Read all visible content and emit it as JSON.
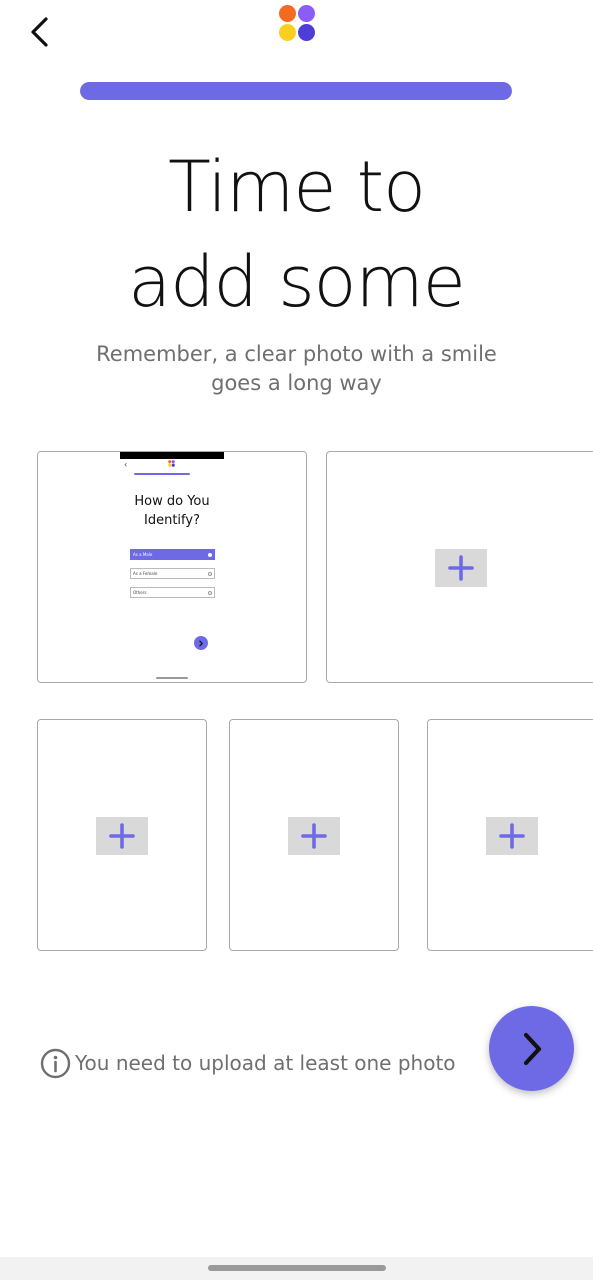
{
  "header": {
    "back_icon": "chevron-left-icon",
    "logo_icon": "four-petal-logo-icon",
    "progress_fraction": 1.0,
    "accent_color": "#6e6ae6"
  },
  "main": {
    "title_line1": "Time to",
    "title_line2": "add some",
    "subtitle_line1": "Remember, a clear photo with a smile",
    "subtitle_line2": "goes a long way"
  },
  "photos": {
    "slot_count": 5,
    "filled_slots": 1,
    "add_icon": "plus-icon",
    "thumbnail": {
      "title_line1": "How do You",
      "title_line2": "Identify?",
      "options": [
        "As a Male",
        "As a Female",
        "Others"
      ]
    }
  },
  "footer": {
    "notice_icon": "info-icon",
    "notice_text": "You need to upload at least one photo",
    "next_icon": "chevron-right-icon"
  }
}
